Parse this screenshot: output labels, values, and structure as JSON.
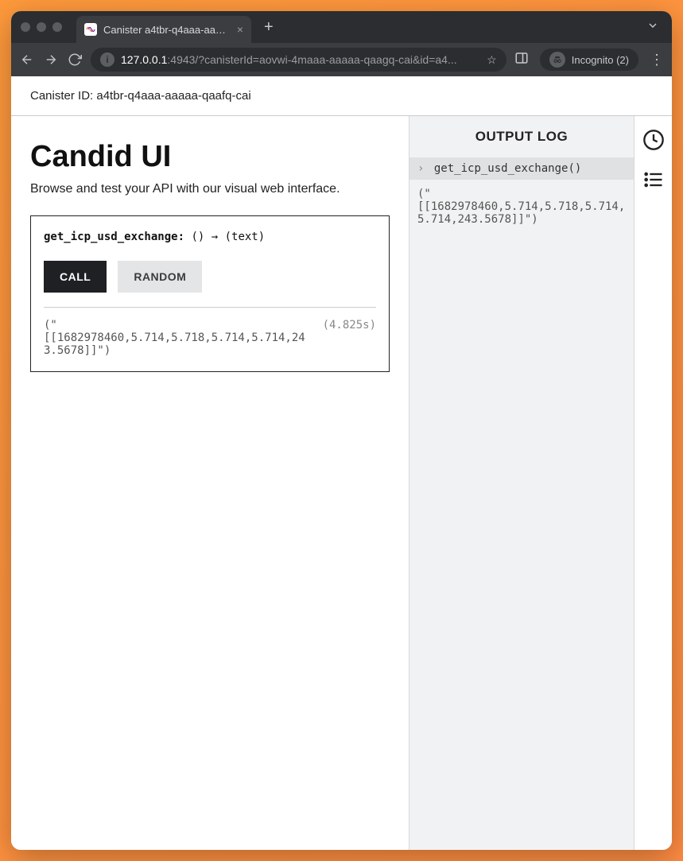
{
  "browser": {
    "tab_title": "Canister a4tbr-q4aaa-aaaaa-q",
    "url_bold": "127.0.0.1",
    "url_rest": ":4943/?canisterId=aovwi-4maaa-aaaaa-qaagq-cai&id=a4...",
    "incognito_label": "Incognito (2)"
  },
  "canister_bar": {
    "label": "Canister ID:",
    "value": "a4tbr-q4aaa-aaaaa-qaafq-cai"
  },
  "heading": "Candid UI",
  "subtitle": "Browse and test your API with our visual web interface.",
  "method": {
    "name": "get_icp_usd_exchange:",
    "sig_rest": " () → (text)",
    "call_label": "CALL",
    "random_label": "RANDOM",
    "result": "(\"\n[[1682978460,5.714,5.718,5.714,5.714,243.5678]]\")",
    "elapsed": "(4.825s)"
  },
  "output_log": {
    "title": "OUTPUT LOG",
    "entry_call": "get_icp_usd_exchange()",
    "entry_body": "(\"\n[[1682978460,5.714,5.718,5.714,5.714,243.5678]]\")"
  }
}
